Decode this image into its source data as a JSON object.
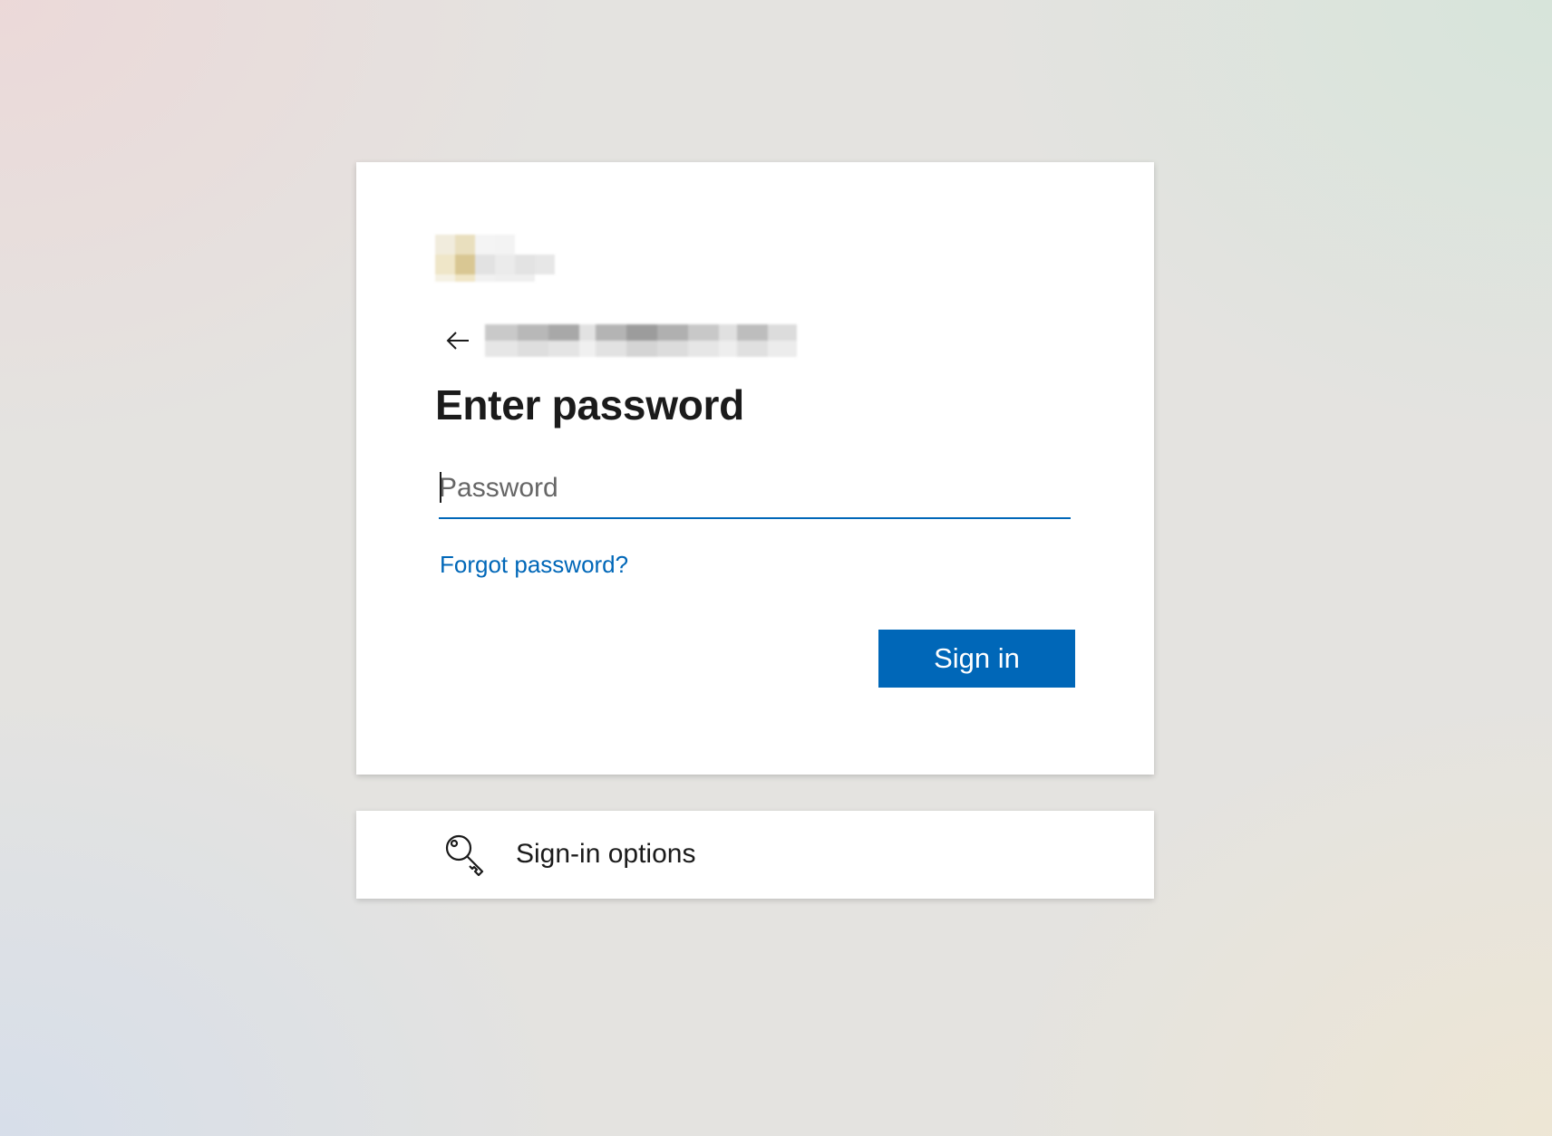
{
  "signin": {
    "title": "Enter password",
    "password_placeholder": "Password",
    "forgot_password": "Forgot password?",
    "sign_in_label": "Sign in",
    "back_icon": "arrow-left-icon",
    "identity_redacted": true,
    "logo_redacted": true
  },
  "options": {
    "label": "Sign-in options",
    "icon": "key-icon"
  },
  "colors": {
    "accent": "#0067b8",
    "text": "#1b1b1b",
    "placeholder": "#666666",
    "card": "#ffffff"
  }
}
